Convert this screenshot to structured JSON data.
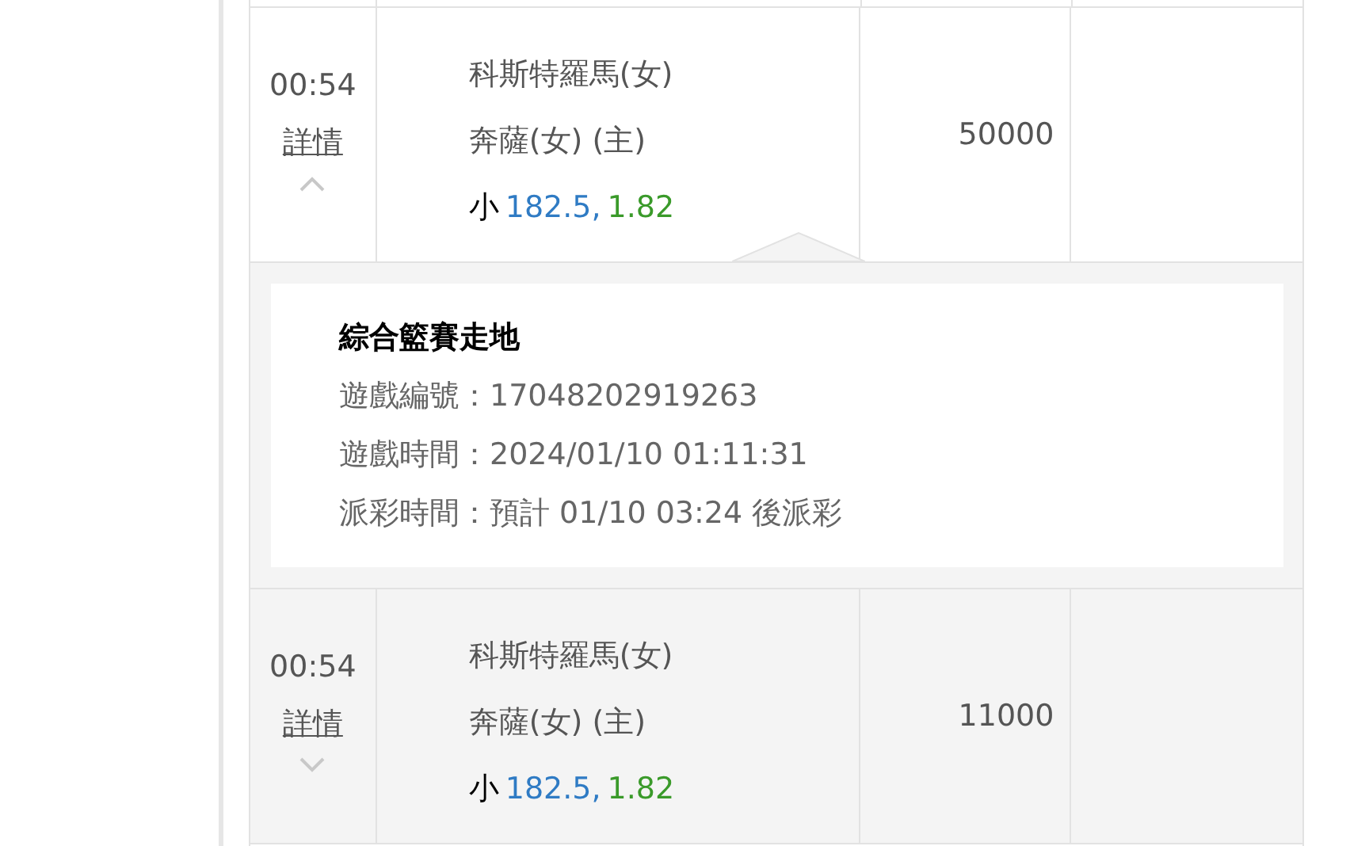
{
  "rows": [
    {
      "time": "00:54",
      "details_link": "詳情",
      "expanded": true,
      "team_1": "科斯特羅馬(女)",
      "team_2": "奔薩(女) (主)",
      "pick": "小",
      "line": "182.5,",
      "odds": "1.82",
      "amount": "50000",
      "detail": {
        "title": "綜合籃賽走地",
        "lines": [
          "遊戲編號：17048202919263",
          "遊戲時間：2024/01/10 01:11:31",
          "派彩時間：預計 01/10 03:24 後派彩"
        ]
      }
    },
    {
      "time": "00:54",
      "details_link": "詳情",
      "expanded": false,
      "team_1": "科斯特羅馬(女)",
      "team_2": "奔薩(女) (主)",
      "pick": "小",
      "line": "182.5,",
      "odds": "1.82",
      "amount": "11000"
    }
  ]
}
